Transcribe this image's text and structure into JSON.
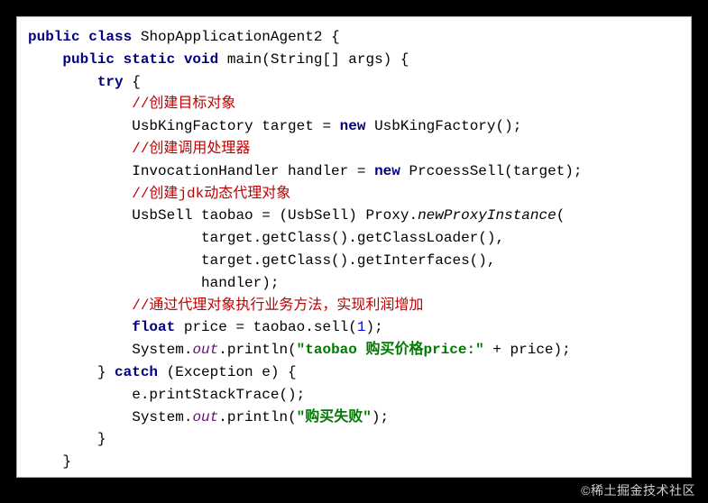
{
  "code": {
    "class_decl_prefix": "public",
    "class_kw": "class",
    "class_name": "ShopApplicationAgent2",
    "main_prefix": "public static void",
    "main_name": "main",
    "main_params": "(String[] args)",
    "try_kw": "try",
    "comment_target": "//创建目标对象",
    "target_line_a": "UsbKingFactory target = ",
    "new_kw": "new",
    "target_line_b": " UsbKingFactory();",
    "comment_handler": "//创建调用处理器",
    "handler_line_a": "InvocationHandler handler = ",
    "handler_line_b": " PrcoessSell(target);",
    "comment_proxy_a": "//创建",
    "comment_proxy_b": "jdk",
    "comment_proxy_c": "动态代理对象",
    "proxy_line_a": "UsbSell taobao = (UsbSell) Proxy.",
    "proxy_method": "newProxyInstance",
    "proxy_paren": "(",
    "proxy_arg1": "target.getClass().getClassLoader(),",
    "proxy_arg2": "target.getClass().getInterfaces(),",
    "proxy_arg3": "handler);",
    "comment_biz": "//通过代理对象执行业务方法，实现利润增加",
    "float_kw": "float",
    "price_line": " price = taobao.sell(",
    "price_num": "1",
    "price_end": ");",
    "print_a": "System.",
    "out_field": "out",
    "println": ".println(",
    "str_price": "\"taobao 购买价格price:\"",
    "print_concat": " + price);",
    "catch_kw": "catch",
    "catch_params": " (Exception e) {",
    "stacktrace": "e.printStackTrace();",
    "str_fail": "\"购买失败\"",
    "println_close": ");"
  },
  "watermark": "©稀土掘金技术社区"
}
